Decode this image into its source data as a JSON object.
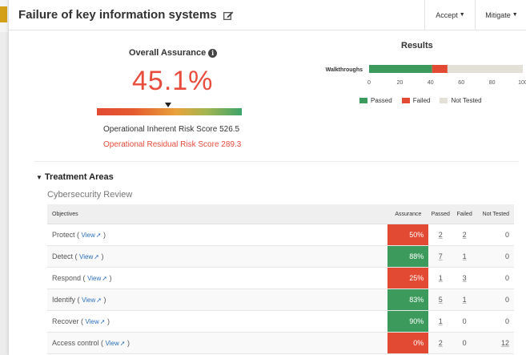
{
  "header": {
    "title": "Failure of key information systems",
    "accept_label": "Accept",
    "mitigate_label": "Mitigate"
  },
  "assurance": {
    "title": "Overall Assurance",
    "info_glyph": "i",
    "value": "45.1%",
    "inherent": "Operational Inherent Risk Score 526.5",
    "residual": "Operational Residual Risk Score 289.3"
  },
  "results": {
    "title": "Results",
    "legend": {
      "passed": "Passed",
      "failed": "Failed",
      "not_tested": "Not Tested"
    }
  },
  "chart_data": {
    "type": "bar",
    "categories": [
      "Walkthroughs"
    ],
    "series": [
      {
        "name": "Passed",
        "values": [
          41
        ],
        "color": "#3d9a5d"
      },
      {
        "name": "Failed",
        "values": [
          10
        ],
        "color": "#e24a33"
      },
      {
        "name": "Not Tested",
        "values": [
          49
        ],
        "color": "#e3e0d8"
      }
    ],
    "xlim": [
      0,
      100
    ],
    "xticks": [
      "0",
      "20",
      "40",
      "60",
      "80",
      "100"
    ],
    "stacked": true,
    "orientation": "horizontal",
    "legend": "bottom"
  },
  "treatment": {
    "title": "Treatment Areas",
    "section": "Cybersecurity Review",
    "columns": {
      "objectives": "Objectives",
      "assurance": "Assurance",
      "passed": "Passed",
      "failed": "Failed",
      "not_tested": "Not Tested"
    },
    "view_label": "View",
    "rows": [
      {
        "name": "Protect",
        "assurance": "50%",
        "color": "#e24a33",
        "passed": "2",
        "failed": "2",
        "not_tested": "0"
      },
      {
        "name": "Detect",
        "assurance": "88%",
        "color": "#3d9a5d",
        "passed": "7",
        "failed": "1",
        "not_tested": "0"
      },
      {
        "name": "Respond",
        "assurance": "25%",
        "color": "#e24a33",
        "passed": "1",
        "failed": "3",
        "not_tested": "0"
      },
      {
        "name": "Identify",
        "assurance": "83%",
        "color": "#3d9a5d",
        "passed": "5",
        "failed": "1",
        "not_tested": "0"
      },
      {
        "name": "Recover",
        "assurance": "90%",
        "color": "#3d9a5d",
        "passed": "1",
        "failed": "0",
        "not_tested": "0"
      },
      {
        "name": "Access control",
        "assurance": "0%",
        "color": "#e24a33",
        "passed": "2",
        "failed": "0",
        "not_tested": "12"
      }
    ]
  }
}
